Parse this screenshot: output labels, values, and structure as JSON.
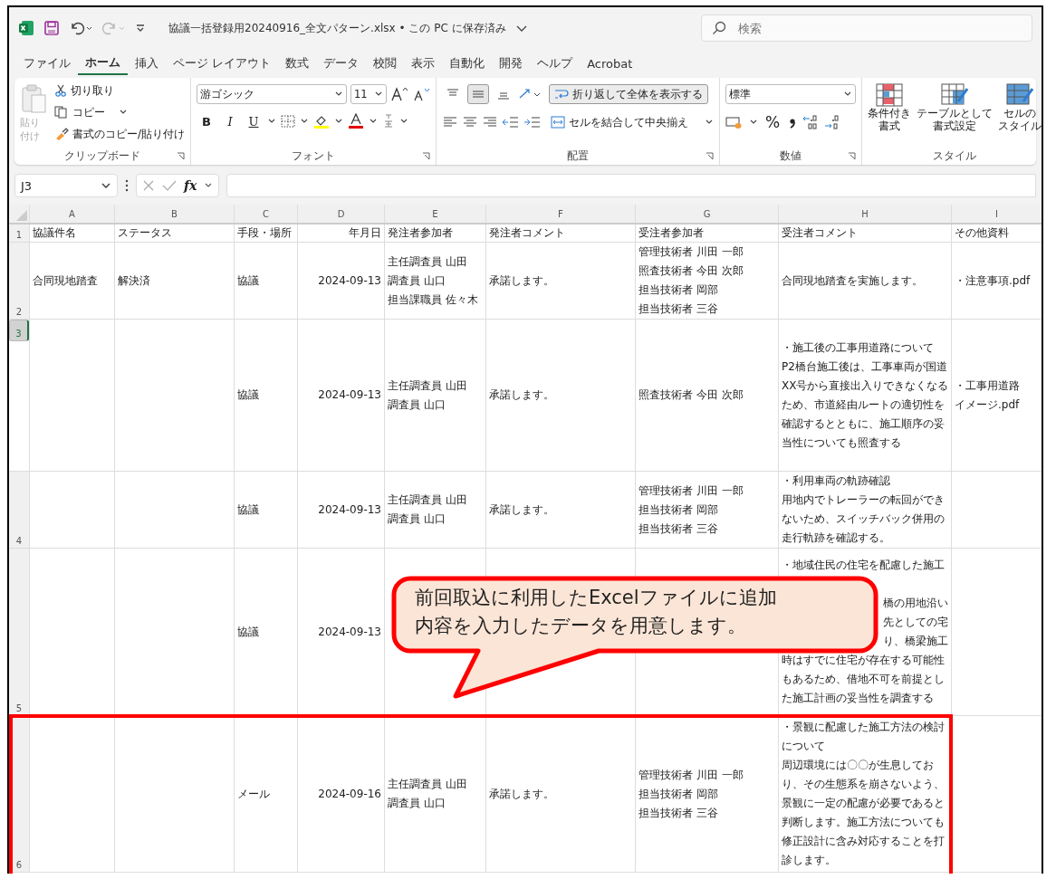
{
  "title_bar": {
    "file_title": "協議一括登録用20240916_全文パターン.xlsx • この PC に保存済み",
    "search_placeholder": "検索"
  },
  "menu_tabs": [
    {
      "label": "ファイル",
      "selected": false
    },
    {
      "label": "ホーム",
      "selected": true
    },
    {
      "label": "挿入",
      "selected": false
    },
    {
      "label": "ページ レイアウト",
      "selected": false
    },
    {
      "label": "数式",
      "selected": false
    },
    {
      "label": "データ",
      "selected": false
    },
    {
      "label": "校閲",
      "selected": false
    },
    {
      "label": "表示",
      "selected": false
    },
    {
      "label": "自動化",
      "selected": false
    },
    {
      "label": "開発",
      "selected": false
    },
    {
      "label": "ヘルプ",
      "selected": false
    },
    {
      "label": "Acrobat",
      "selected": false
    }
  ],
  "clipboard": {
    "paste": "貼り付け",
    "cut": "切り取り",
    "copy": "コピー",
    "format_painter": "書式のコピー/貼り付け",
    "group_label": "クリップボード"
  },
  "font": {
    "font_name": "游ゴシック",
    "font_size": "11",
    "bold": "B",
    "italic": "I",
    "underline": "U",
    "group_label": "フォント"
  },
  "alignment": {
    "vertical": [
      {
        "kind": "top",
        "on": false
      },
      {
        "kind": "middle",
        "on": true
      },
      {
        "kind": "bottom",
        "on": false
      }
    ],
    "wrap_text": {
      "label": "折り返して全体を表示する",
      "on": true
    },
    "merge_center": "セルを結合して中央揃え",
    "group_label": "配置"
  },
  "number": {
    "format": "標準",
    "percent": "%",
    "group_label": "数値"
  },
  "styles": {
    "buttons": [
      {
        "kind": "conditional",
        "lines": [
          "条件付き",
          "書式"
        ]
      },
      {
        "kind": "table",
        "lines": [
          "テーブルとして",
          "書式設定"
        ]
      },
      {
        "kind": "cell",
        "lines": [
          "セルの",
          "スタイル"
        ]
      }
    ],
    "group_label": "スタイル"
  },
  "formula_bar": {
    "name_box": "J3",
    "function_label": "fx"
  },
  "columns": [
    {
      "letter": "A",
      "kind": "text"
    },
    {
      "letter": "B",
      "kind": "text"
    },
    {
      "letter": "C",
      "kind": "text"
    },
    {
      "letter": "D",
      "kind": "date"
    },
    {
      "letter": "E",
      "kind": "text"
    },
    {
      "letter": "F",
      "kind": "text"
    },
    {
      "letter": "G",
      "kind": "text"
    },
    {
      "letter": "H",
      "kind": "text"
    },
    {
      "letter": "I",
      "kind": "text"
    }
  ],
  "rows": [
    {
      "number": "1",
      "selected": false,
      "cells": [
        [
          "協議件名"
        ],
        [
          "ステータス"
        ],
        [
          "手段・場所"
        ],
        [
          "年月日"
        ],
        [
          "発注者参加者"
        ],
        [
          "発注者コメント"
        ],
        [
          "受注者参加者"
        ],
        [
          "受注者コメント"
        ],
        [
          "その他資料"
        ]
      ]
    },
    {
      "number": "2",
      "selected": false,
      "cells": [
        [
          "合同現地踏査"
        ],
        [
          "解決済"
        ],
        [
          "協議"
        ],
        [
          "2024-09-13"
        ],
        [
          "主任調査員 山田",
          "調査員 山口",
          "担当課職員 佐々木"
        ],
        [
          "承諾します。"
        ],
        [
          "管理技術者 川田 一郎",
          "照査技術者 今田 次郎",
          "担当技術者 岡部",
          "担当技術者 三谷"
        ],
        [
          "合同現地踏査を実施します。"
        ],
        [
          "・注意事項.pdf"
        ]
      ]
    },
    {
      "number": "3",
      "selected": true,
      "cells": [
        [],
        [],
        [
          "協議"
        ],
        [
          "2024-09-13"
        ],
        [
          "主任調査員 山田",
          "調査員 山口"
        ],
        [
          "承諾します。"
        ],
        [
          "照査技術者 今田 次郎"
        ],
        [
          "・施工後の工事用道路について",
          "P2橋台施工後は、工事車両が国道",
          "XX号から直接出入りできなくなる",
          "ため、市道経由ルートの適切性を",
          "確認するとともに、施工順序の妥",
          "当性についても照査する"
        ],
        [
          "・工事用道路",
          "イメージ.pdf"
        ]
      ]
    },
    {
      "number": "4",
      "selected": false,
      "cells": [
        [],
        [],
        [
          "協議"
        ],
        [
          "2024-09-13"
        ],
        [
          "主任調査員 山田",
          "調査員 山口"
        ],
        [
          "承諾します。"
        ],
        [
          "管理技術者 川田 一郎",
          "担当技術者 岡部",
          "担当技術者 三谷"
        ],
        [
          "・利用車両の軌跡確認",
          "用地内でトレーラーの転回ができ",
          "ないため、スイッチバック併用の",
          "走行軌跡を確認する。"
        ],
        []
      ]
    },
    {
      "number": "5",
      "selected": false,
      "cells": [
        [],
        [],
        [
          "協議"
        ],
        [
          "2024-09-13"
        ],
        [],
        [],
        [],
        [
          "・地域住民の住宅を配慮した施工",
          "橋の用地沿い",
          "先としての宅",
          "り、橋梁施工",
          "時はすでに住宅が存在する可能性",
          "もあるため、借地不可を前提とし",
          "た施工計画の妥当性を調査する"
        ],
        []
      ]
    },
    {
      "number": "6",
      "selected": false,
      "cells": [
        [],
        [],
        [
          "メール"
        ],
        [
          "2024-09-16"
        ],
        [
          "主任調査員 山田",
          "調査員 山口"
        ],
        [
          "承諾します。"
        ],
        [
          "管理技術者 川田 一郎",
          "担当技術者 岡部",
          "担当技術者 三谷"
        ],
        [
          "・景観に配慮した施工方法の検討",
          "について",
          "周辺環境には〇〇が生息してお",
          "り、その生態系を崩さないよう、",
          "景観に一定の配慮が必要であると",
          "判断します。施工方法についても",
          "修正設計に含み対応することを打",
          "診します。"
        ],
        []
      ]
    }
  ],
  "callout": {
    "text": "前回取込に利用したExcelファイルに追加内容を入力したデータを用意します。"
  }
}
